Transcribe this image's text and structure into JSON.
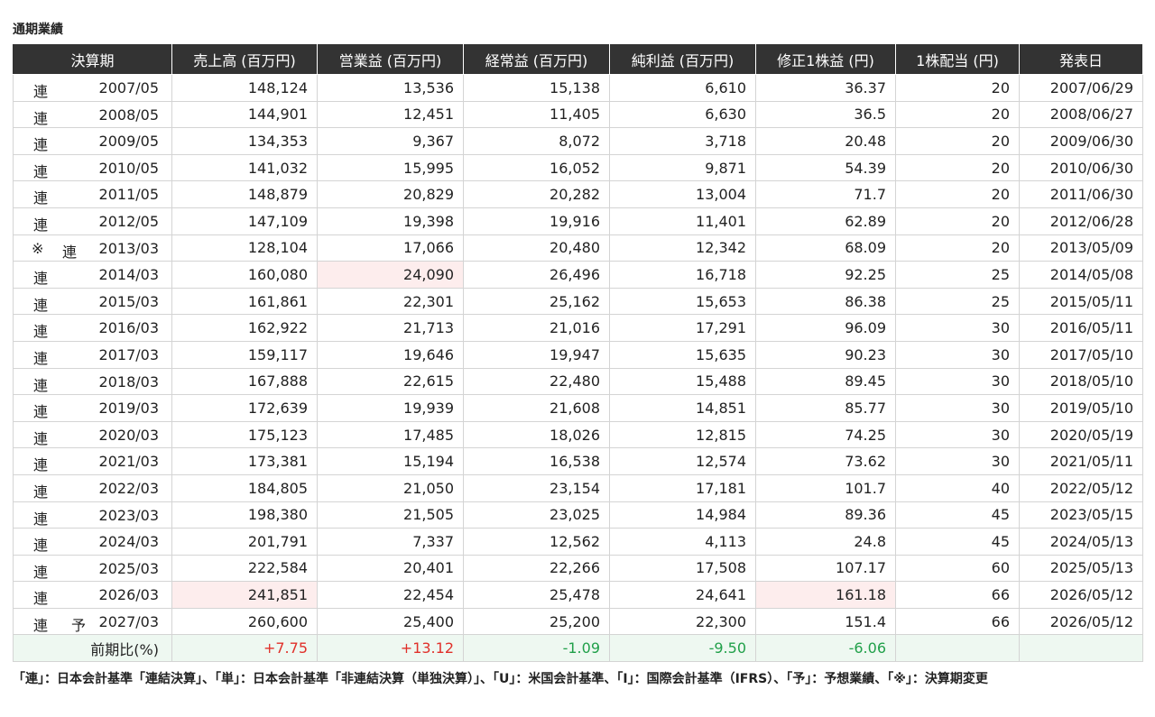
{
  "title": "通期業績",
  "headers": [
    "決算期",
    "売上高 (百万円)",
    "営業益 (百万円)",
    "経常益 (百万円)",
    "純利益 (百万円)",
    "修正1株益 (円)",
    "1株配当 (円)",
    "発表日"
  ],
  "rows": [
    {
      "mark": "",
      "type": "連",
      "forecast": "",
      "period": "2007/05",
      "sales": "148,124",
      "op": "13,536",
      "ord": "15,138",
      "net": "6,610",
      "eps": "36.37",
      "div": "20",
      "date": "2007/06/29"
    },
    {
      "mark": "",
      "type": "連",
      "forecast": "",
      "period": "2008/05",
      "sales": "144,901",
      "op": "12,451",
      "ord": "11,405",
      "net": "6,630",
      "eps": "36.5",
      "div": "20",
      "date": "2008/06/27"
    },
    {
      "mark": "",
      "type": "連",
      "forecast": "",
      "period": "2009/05",
      "sales": "134,353",
      "op": "9,367",
      "ord": "8,072",
      "net": "3,718",
      "eps": "20.48",
      "div": "20",
      "date": "2009/06/30"
    },
    {
      "mark": "",
      "type": "連",
      "forecast": "",
      "period": "2010/05",
      "sales": "141,032",
      "op": "15,995",
      "ord": "16,052",
      "net": "9,871",
      "eps": "54.39",
      "div": "20",
      "date": "2010/06/30"
    },
    {
      "mark": "",
      "type": "連",
      "forecast": "",
      "period": "2011/05",
      "sales": "148,879",
      "op": "20,829",
      "ord": "20,282",
      "net": "13,004",
      "eps": "71.7",
      "div": "20",
      "date": "2011/06/30"
    },
    {
      "mark": "",
      "type": "連",
      "forecast": "",
      "period": "2012/05",
      "sales": "147,109",
      "op": "19,398",
      "ord": "19,916",
      "net": "11,401",
      "eps": "62.89",
      "div": "20",
      "date": "2012/06/28"
    },
    {
      "mark": "※",
      "type": "連",
      "forecast": "",
      "period": "2013/03",
      "sales": "128,104",
      "op": "17,066",
      "ord": "20,480",
      "net": "12,342",
      "eps": "68.09",
      "div": "20",
      "date": "2013/05/09"
    },
    {
      "mark": "",
      "type": "連",
      "forecast": "",
      "period": "2014/03",
      "sales": "160,080",
      "op": "24,090",
      "ord": "26,496",
      "net": "16,718",
      "eps": "92.25",
      "div": "25",
      "date": "2014/05/08",
      "hl": [
        "op"
      ]
    },
    {
      "mark": "",
      "type": "連",
      "forecast": "",
      "period": "2015/03",
      "sales": "161,861",
      "op": "22,301",
      "ord": "25,162",
      "net": "15,653",
      "eps": "86.38",
      "div": "25",
      "date": "2015/05/11"
    },
    {
      "mark": "",
      "type": "連",
      "forecast": "",
      "period": "2016/03",
      "sales": "162,922",
      "op": "21,713",
      "ord": "21,016",
      "net": "17,291",
      "eps": "96.09",
      "div": "30",
      "date": "2016/05/11"
    },
    {
      "mark": "",
      "type": "連",
      "forecast": "",
      "period": "2017/03",
      "sales": "159,117",
      "op": "19,646",
      "ord": "19,947",
      "net": "15,635",
      "eps": "90.23",
      "div": "30",
      "date": "2017/05/10"
    },
    {
      "mark": "",
      "type": "連",
      "forecast": "",
      "period": "2018/03",
      "sales": "167,888",
      "op": "22,615",
      "ord": "22,480",
      "net": "15,488",
      "eps": "89.45",
      "div": "30",
      "date": "2018/05/10"
    },
    {
      "mark": "",
      "type": "連",
      "forecast": "",
      "period": "2019/03",
      "sales": "172,639",
      "op": "19,939",
      "ord": "21,608",
      "net": "14,851",
      "eps": "85.77",
      "div": "30",
      "date": "2019/05/10"
    },
    {
      "mark": "",
      "type": "連",
      "forecast": "",
      "period": "2020/03",
      "sales": "175,123",
      "op": "17,485",
      "ord": "18,026",
      "net": "12,815",
      "eps": "74.25",
      "div": "30",
      "date": "2020/05/19"
    },
    {
      "mark": "",
      "type": "連",
      "forecast": "",
      "period": "2021/03",
      "sales": "173,381",
      "op": "15,194",
      "ord": "16,538",
      "net": "12,574",
      "eps": "73.62",
      "div": "30",
      "date": "2021/05/11"
    },
    {
      "mark": "",
      "type": "連",
      "forecast": "",
      "period": "2022/03",
      "sales": "184,805",
      "op": "21,050",
      "ord": "23,154",
      "net": "17,181",
      "eps": "101.7",
      "div": "40",
      "date": "2022/05/12"
    },
    {
      "mark": "",
      "type": "連",
      "forecast": "",
      "period": "2023/03",
      "sales": "198,380",
      "op": "21,505",
      "ord": "23,025",
      "net": "14,984",
      "eps": "89.36",
      "div": "45",
      "date": "2023/05/15"
    },
    {
      "mark": "",
      "type": "連",
      "forecast": "",
      "period": "2024/03",
      "sales": "201,791",
      "op": "7,337",
      "ord": "12,562",
      "net": "4,113",
      "eps": "24.8",
      "div": "45",
      "date": "2024/05/13"
    },
    {
      "mark": "",
      "type": "連",
      "forecast": "",
      "period": "2025/03",
      "sales": "222,584",
      "op": "20,401",
      "ord": "22,266",
      "net": "17,508",
      "eps": "107.17",
      "div": "60",
      "date": "2025/05/13"
    },
    {
      "mark": "",
      "type": "連",
      "forecast": "",
      "period": "2026/03",
      "sales": "241,851",
      "op": "22,454",
      "ord": "25,478",
      "net": "24,641",
      "eps": "161.18",
      "div": "66",
      "date": "2026/05/12",
      "hl": [
        "sales",
        "eps"
      ]
    },
    {
      "mark": "",
      "type": "連",
      "forecast": "予",
      "period": "2027/03",
      "sales": "260,600",
      "op": "25,400",
      "ord": "25,200",
      "net": "22,300",
      "eps": "151.4",
      "div": "66",
      "date": "2026/05/12"
    }
  ],
  "ratio": {
    "label": "前期比(%)",
    "sales": "+7.75",
    "op": "+13.12",
    "ord": "-1.09",
    "net": "-9.50",
    "eps": "-6.06",
    "div": "",
    "date": ""
  },
  "colors": {
    "header_bg": "#333333",
    "highlight_bg": "#fdeded",
    "ratio_bg": "#eef8f1",
    "positive": "#e0302a",
    "negative": "#21a04a"
  },
  "note": "「連」：日本会計基準「連結決算」、「単」：日本会計基準「非連結決算（単独決算）」、「U」：米国会計基準、「I」：国際会計基準（IFRS）、「予」：予想業績、「※」：決算期変更"
}
